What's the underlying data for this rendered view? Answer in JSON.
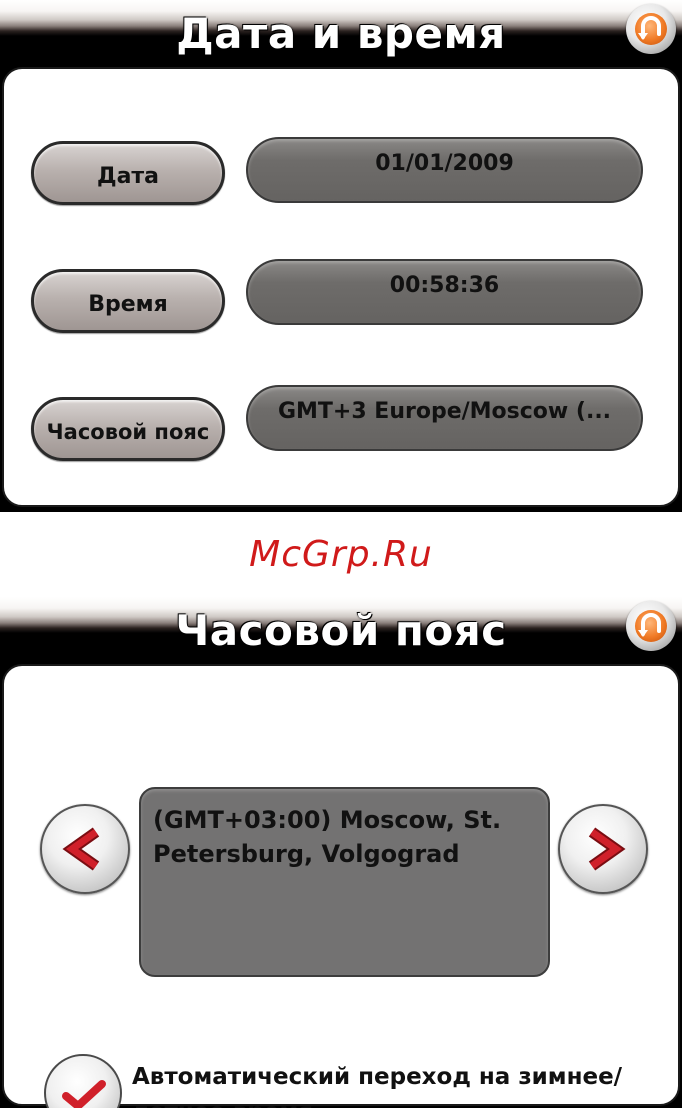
{
  "screen_date_time": {
    "title": "Дата и время",
    "back_button_icon": "back-arrow-icon",
    "rows": [
      {
        "label": "Дата",
        "value": "01/01/2009"
      },
      {
        "label": "Время",
        "value": "00:58:36"
      },
      {
        "label": "Часовой пояс",
        "value": "GMT+3 Europe/Moscow (..."
      }
    ]
  },
  "watermark": "McGrp.Ru",
  "screen_timezone": {
    "title": "Часовой пояс",
    "back_button_icon": "back-arrow-icon",
    "prev_icon": "chevron-left-icon",
    "next_icon": "chevron-right-icon",
    "timezone_text": "(GMT+03:00) Moscow, St. Petersburg, Volgograd",
    "dst_checkbox": {
      "checked": true,
      "label": "Автоматический переход на зимнее/ летнее время"
    }
  },
  "colors": {
    "accent_orange": "#f07a25",
    "arrow_red": "#d0202a",
    "watermark_red": "#d01a1a",
    "field_gray": "#737272"
  }
}
